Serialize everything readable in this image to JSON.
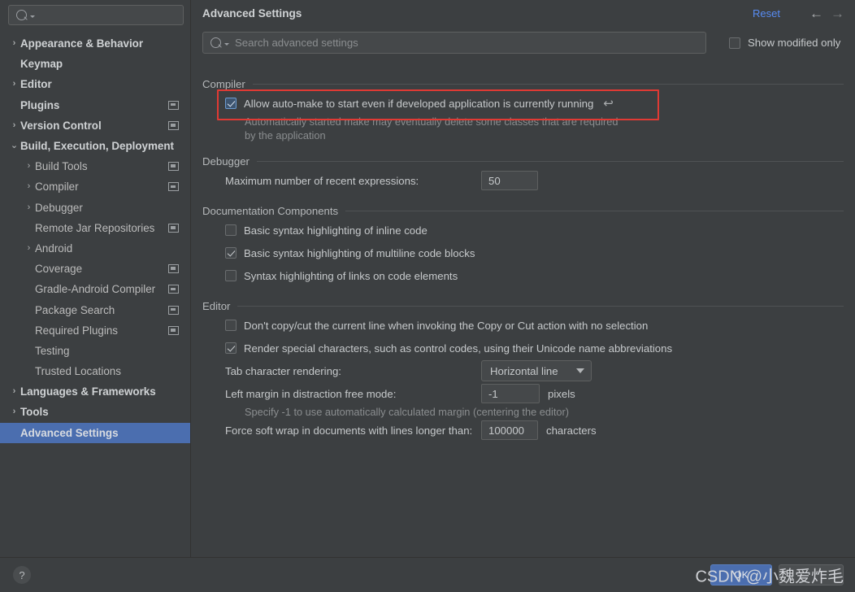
{
  "sidebar": {
    "search": {
      "placeholder": "",
      "value": "",
      "icon": "search-icon"
    },
    "items": [
      {
        "label": "Appearance & Behavior",
        "twisty": "›",
        "indent": 0,
        "bold": true,
        "icon": "",
        "selected": false
      },
      {
        "label": "Keymap",
        "twisty": "",
        "indent": 0,
        "bold": true,
        "icon": "",
        "selected": false
      },
      {
        "label": "Editor",
        "twisty": "›",
        "indent": 0,
        "bold": true,
        "icon": "",
        "selected": false
      },
      {
        "label": "Plugins",
        "twisty": "",
        "indent": 0,
        "bold": true,
        "icon": "module-icon",
        "selected": false
      },
      {
        "label": "Version Control",
        "twisty": "›",
        "indent": 0,
        "bold": true,
        "icon": "module-icon",
        "selected": false
      },
      {
        "label": "Build, Execution, Deployment",
        "twisty": "⌄",
        "indent": 0,
        "bold": true,
        "icon": "",
        "selected": false
      },
      {
        "label": "Build Tools",
        "twisty": "›",
        "indent": 1,
        "bold": false,
        "icon": "module-icon",
        "selected": false
      },
      {
        "label": "Compiler",
        "twisty": "›",
        "indent": 1,
        "bold": false,
        "icon": "module-icon",
        "selected": false
      },
      {
        "label": "Debugger",
        "twisty": "›",
        "indent": 1,
        "bold": false,
        "icon": "",
        "selected": false
      },
      {
        "label": "Remote Jar Repositories",
        "twisty": "",
        "indent": 1,
        "bold": false,
        "icon": "module-icon",
        "selected": false
      },
      {
        "label": "Android",
        "twisty": "›",
        "indent": 1,
        "bold": false,
        "icon": "",
        "selected": false
      },
      {
        "label": "Coverage",
        "twisty": "",
        "indent": 1,
        "bold": false,
        "icon": "module-icon",
        "selected": false
      },
      {
        "label": "Gradle-Android Compiler",
        "twisty": "",
        "indent": 1,
        "bold": false,
        "icon": "module-icon",
        "selected": false
      },
      {
        "label": "Package Search",
        "twisty": "",
        "indent": 1,
        "bold": false,
        "icon": "module-icon",
        "selected": false
      },
      {
        "label": "Required Plugins",
        "twisty": "",
        "indent": 1,
        "bold": false,
        "icon": "module-icon",
        "selected": false
      },
      {
        "label": "Testing",
        "twisty": "",
        "indent": 1,
        "bold": false,
        "icon": "",
        "selected": false
      },
      {
        "label": "Trusted Locations",
        "twisty": "",
        "indent": 1,
        "bold": false,
        "icon": "",
        "selected": false
      },
      {
        "label": "Languages & Frameworks",
        "twisty": "›",
        "indent": 0,
        "bold": true,
        "icon": "",
        "selected": false
      },
      {
        "label": "Tools",
        "twisty": "›",
        "indent": 0,
        "bold": true,
        "icon": "",
        "selected": false
      },
      {
        "label": "Advanced Settings",
        "twisty": "",
        "indent": 0,
        "bold": true,
        "icon": "",
        "selected": true
      }
    ]
  },
  "header": {
    "title": "Advanced Settings",
    "reset_label": "Reset",
    "back_arrow": "←",
    "forward_arrow": "→",
    "search_placeholder": "Search advanced settings",
    "search_value": "",
    "show_modified_label": "Show modified only",
    "show_modified_checked": false,
    "accent_color": "#4b6eaf",
    "link_color": "#588cf3",
    "highlight_color": "#e03a34"
  },
  "sections": [
    {
      "title": "Compiler",
      "rows": [
        {
          "kind": "checkbox",
          "label": "Allow auto-make to start even if developed application is currently running",
          "checked": true,
          "modified": true,
          "revert_icon": "revert-arrow-icon",
          "highlighted": true,
          "hint": "Automatically started make may eventually delete some classes that are required by the application"
        }
      ]
    },
    {
      "title": "Debugger",
      "rows": [
        {
          "kind": "textfield",
          "label": "Maximum number of recent expressions:",
          "value": "50",
          "unit": ""
        }
      ]
    },
    {
      "title": "Documentation Components",
      "rows": [
        {
          "kind": "checkbox",
          "label": "Basic syntax highlighting of inline code",
          "checked": false,
          "modified": false,
          "hint": ""
        },
        {
          "kind": "checkbox",
          "label": "Basic syntax highlighting of multiline code blocks",
          "checked": true,
          "modified": false,
          "hint": ""
        },
        {
          "kind": "checkbox",
          "label": "Syntax highlighting of links on code elements",
          "checked": false,
          "modified": false,
          "hint": ""
        }
      ]
    },
    {
      "title": "Editor",
      "rows": [
        {
          "kind": "checkbox",
          "label": "Don't copy/cut the current line when invoking the Copy or Cut action with no selection",
          "checked": false,
          "modified": false,
          "hint": ""
        },
        {
          "kind": "checkbox",
          "label": "Render special characters, such as control codes, using their Unicode name abbreviations",
          "checked": true,
          "modified": false,
          "hint": ""
        },
        {
          "kind": "combo",
          "label": "Tab character rendering:",
          "value": "Horizontal line",
          "unit": ""
        },
        {
          "kind": "textfield",
          "label": "Left margin in distraction free mode:",
          "value": "-1",
          "unit": "pixels",
          "hint": "Specify -1 to use automatically calculated margin (centering the editor)"
        },
        {
          "kind": "textfield-cut",
          "label": "Force soft wrap in documents with lines longer than:",
          "value": "100000",
          "unit": "characters"
        }
      ]
    }
  ],
  "footer": {
    "help_label": "?",
    "ok_label": "OK",
    "cancel_label": "",
    "watermark": "CSDN @小魏爱炸毛"
  }
}
